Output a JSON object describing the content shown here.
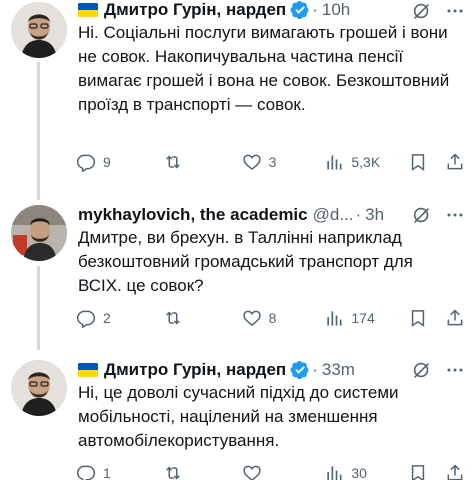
{
  "tweets": [
    {
      "author": "Дмитро Гурін, нардеп",
      "has_flag": true,
      "verified": true,
      "handle": "",
      "time": "10h",
      "text": "Ні. Соціальні послуги вимагають грошей і вони не совок. Накопичувальна частина пенсії вимагає грошей і вона не совок. Безкоштовний проїзд в транспорті — совок.",
      "replies": "9",
      "reposts": "",
      "likes": "3",
      "views": "5,3K"
    },
    {
      "author": "mykhaylovich, the academic",
      "has_flag": false,
      "verified": false,
      "handle": "@d...",
      "time": "3h",
      "text": "Дмитре, ви брехун. в Таллінні наприклад безкоштовний громадський транспорт для ВСІХ. це совок?",
      "replies": "2",
      "reposts": "",
      "likes": "8",
      "views": "174"
    },
    {
      "author": "Дмитро Гурін, нардеп",
      "has_flag": true,
      "verified": true,
      "handle": "",
      "time": "33m",
      "text": "Ні, це доволі сучасний підхід до системи мобільності, націлений на зменшення автомобілекористування.",
      "replies": "1",
      "reposts": "",
      "likes": "",
      "views": "30"
    }
  ],
  "colors": {
    "text": "#0f1419",
    "muted": "#536471",
    "verified_blue": "#1d9bf0",
    "thread_line": "#cfd9de",
    "flag_blue": "#0057b7",
    "flag_yellow": "#ffd700"
  },
  "icons": [
    "reply-icon",
    "repost-icon",
    "like-icon",
    "views-icon",
    "bookmark-icon",
    "share-icon",
    "grok-icon",
    "more-icon",
    "verified-badge-icon"
  ]
}
